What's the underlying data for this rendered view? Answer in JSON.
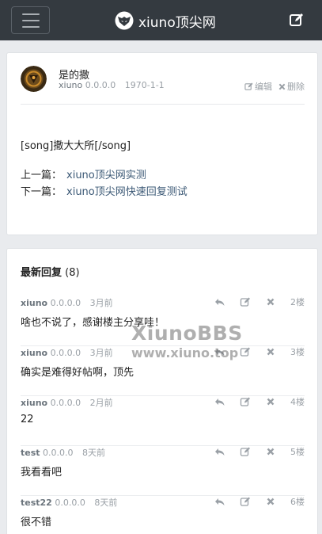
{
  "header": {
    "brand": "xiuno顶尖网"
  },
  "thread": {
    "title": "是的撒",
    "author": "xiuno",
    "ip": "0.0.0.0",
    "date": "1970-1-1",
    "edit_label": "编辑",
    "delete_label": "删除",
    "body": "[song]撒大大所[/song]",
    "prev_label": "上一篇：",
    "prev_link": "xiuno顶尖网实测",
    "next_label": "下一篇：",
    "next_link": "xiuno顶尖网快速回复测试"
  },
  "replies": {
    "heading": "最新回复",
    "count": "(8)",
    "items": [
      {
        "user": "xiuno",
        "ip": "0.0.0.0",
        "time": "3月前",
        "floor": "2楼",
        "content": "啥也不说了，感谢楼主分享哇！"
      },
      {
        "user": "xiuno",
        "ip": "0.0.0.0",
        "time": "3月前",
        "floor": "3楼",
        "content": "确实是难得好帖啊，顶先"
      },
      {
        "user": "xiuno",
        "ip": "0.0.0.0",
        "time": "2月前",
        "floor": "4楼",
        "content": "22"
      },
      {
        "user": "test",
        "ip": "0.0.0.0",
        "time": "8天前",
        "floor": "5楼",
        "content": "我看看吧"
      },
      {
        "user": "test22",
        "ip": "0.0.0.0",
        "time": "8天前",
        "floor": "6楼",
        "content": "很不错"
      }
    ]
  },
  "watermark": {
    "line1": "XiunoBBS",
    "line2": "www.xiuno.top"
  },
  "colors": {
    "topbar": "#343a40",
    "link": "#3b5875",
    "muted": "#9aa0a6"
  }
}
